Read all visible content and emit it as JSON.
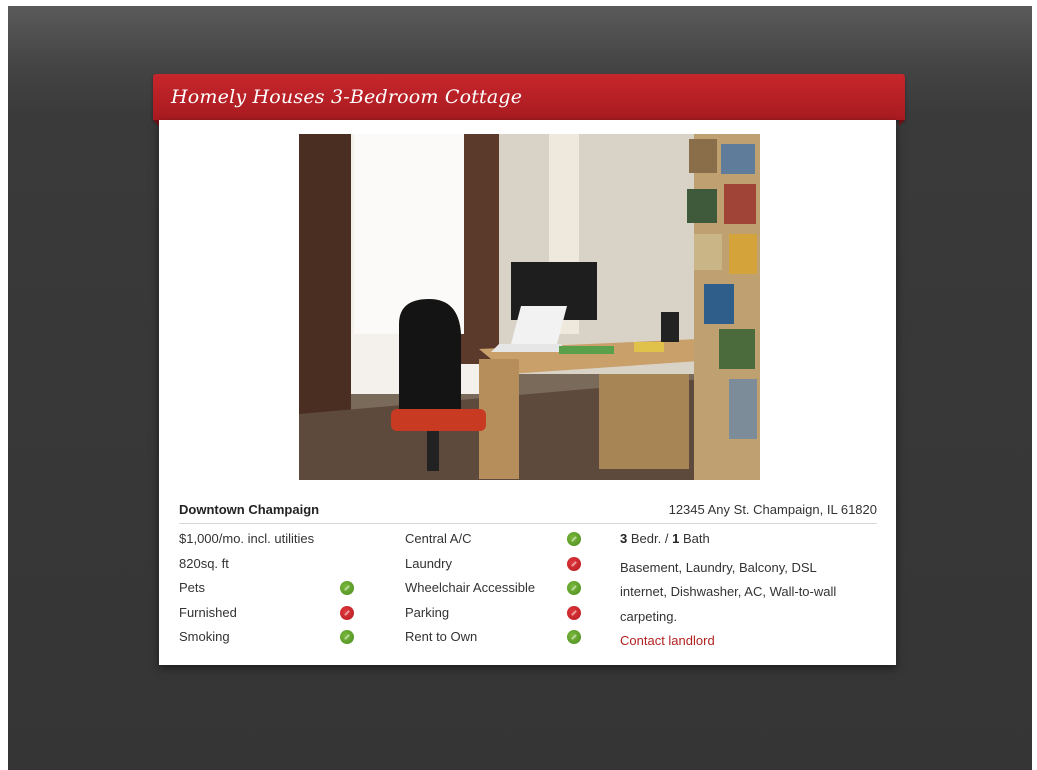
{
  "listing": {
    "title": "Homely Houses 3-Bedroom Cottage",
    "photo_alt": "Bedroom with desk, computer, office chair and window",
    "area": "Downtown Champaign",
    "address": "12345 Any St. Champaign, IL 61820",
    "price": "$1,000/mo. incl. utilities",
    "size": "820sq. ft",
    "beds_count": "3",
    "beds_label": "Bedr.",
    "separator": "/",
    "baths_count": "1",
    "baths_label": "Bath",
    "description": "Basement, Laundry, Balcony, DSL internet, Dishwasher, AC, Wall-to-wall carpeting.",
    "contact_label": "Contact landlord"
  },
  "amenities_left": [
    {
      "label": "Pets",
      "available": true
    },
    {
      "label": "Furnished",
      "available": false
    },
    {
      "label": "Smoking",
      "available": true
    }
  ],
  "amenities_right": [
    {
      "label": "Central A/C",
      "available": true
    },
    {
      "label": "Laundry",
      "available": false
    },
    {
      "label": "Wheelchair Accessible",
      "available": true
    },
    {
      "label": "Parking",
      "available": false
    },
    {
      "label": "Rent to Own",
      "available": true
    }
  ],
  "colors": {
    "banner": "#c7262c",
    "available": "#5a9e2a",
    "unavailable": "#c4252a",
    "link": "#b22222",
    "background": "#3a3a3a"
  },
  "icons": {
    "available": "green-check-dot-icon",
    "unavailable": "red-cross-dot-icon"
  }
}
